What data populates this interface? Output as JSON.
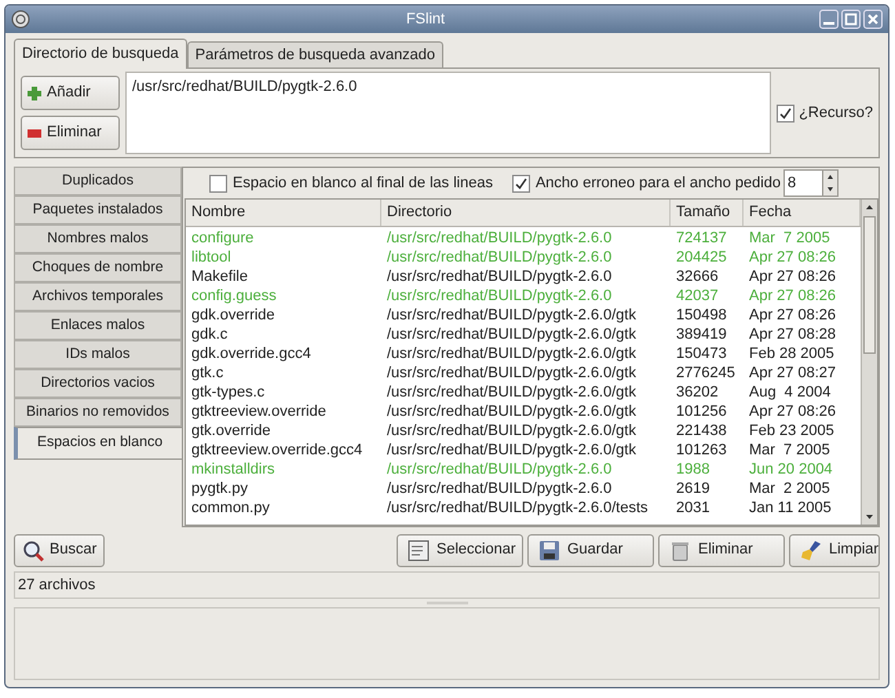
{
  "window": {
    "title": "FSlint"
  },
  "tabs": [
    {
      "label": "Directorio de busqueda",
      "selected": true
    },
    {
      "label": "Parámetros de busqueda avanzado",
      "selected": false
    }
  ],
  "dir_buttons": [
    "Añadir",
    "Eliminar"
  ],
  "directories": [
    "/usr/src/redhat/BUILD/pygtk-2.6.0"
  ],
  "recurse": {
    "label": "¿Recurso?",
    "checked": true
  },
  "side_tabs": [
    {
      "label": "Duplicados",
      "selected": false
    },
    {
      "label": "Paquetes instalados",
      "selected": false
    },
    {
      "label": "Nombres malos",
      "selected": false
    },
    {
      "label": "Choques de nombre",
      "selected": false
    },
    {
      "label": "Archivos temporales",
      "selected": false
    },
    {
      "label": "Enlaces malos",
      "selected": false
    },
    {
      "label": "IDs malos",
      "selected": false
    },
    {
      "label": "Directorios vacios",
      "selected": false
    },
    {
      "label": "Binarios no removidos",
      "selected": false
    },
    {
      "label": "Espacios en blanco",
      "selected": true
    }
  ],
  "options": [
    {
      "label": "Espacio en blanco al final de las lineas",
      "checked": false
    },
    {
      "label": "Ancho erroneo para el ancho pedido",
      "checked": true
    }
  ],
  "width_value": "8",
  "table": {
    "columns": [
      "Nombre",
      "Directorio",
      "Tamaño",
      "Fecha"
    ],
    "rows": [
      {
        "cells": [
          "configure",
          "/usr/src/redhat/BUILD/pygtk-2.6.0",
          "724137",
          "Mar  7 2005"
        ],
        "color": "#4caf3c"
      },
      {
        "cells": [
          "libtool",
          "/usr/src/redhat/BUILD/pygtk-2.6.0",
          "204425",
          "Apr 27 08:26"
        ],
        "color": "#4caf3c"
      },
      {
        "cells": [
          "Makefile",
          "/usr/src/redhat/BUILD/pygtk-2.6.0",
          "32666",
          "Apr 27 08:26"
        ],
        "color": "#222222"
      },
      {
        "cells": [
          "config.guess",
          "/usr/src/redhat/BUILD/pygtk-2.6.0",
          "42037",
          "Apr 27 08:26"
        ],
        "color": "#4caf3c"
      },
      {
        "cells": [
          "gdk.override",
          "/usr/src/redhat/BUILD/pygtk-2.6.0/gtk",
          "150498",
          "Apr 27 08:26"
        ],
        "color": "#222222"
      },
      {
        "cells": [
          "gdk.c",
          "/usr/src/redhat/BUILD/pygtk-2.6.0/gtk",
          "389419",
          "Apr 27 08:28"
        ],
        "color": "#222222"
      },
      {
        "cells": [
          "gdk.override.gcc4",
          "/usr/src/redhat/BUILD/pygtk-2.6.0/gtk",
          "150473",
          "Feb 28 2005"
        ],
        "color": "#222222"
      },
      {
        "cells": [
          "gtk.c",
          "/usr/src/redhat/BUILD/pygtk-2.6.0/gtk",
          "2776245",
          "Apr 27 08:27"
        ],
        "color": "#222222"
      },
      {
        "cells": [
          "gtk-types.c",
          "/usr/src/redhat/BUILD/pygtk-2.6.0/gtk",
          "36202",
          "Aug  4 2004"
        ],
        "color": "#222222"
      },
      {
        "cells": [
          "gtktreeview.override",
          "/usr/src/redhat/BUILD/pygtk-2.6.0/gtk",
          "101256",
          "Apr 27 08:26"
        ],
        "color": "#222222"
      },
      {
        "cells": [
          "gtk.override",
          "/usr/src/redhat/BUILD/pygtk-2.6.0/gtk",
          "221438",
          "Feb 23 2005"
        ],
        "color": "#222222"
      },
      {
        "cells": [
          "gtktreeview.override.gcc4",
          "/usr/src/redhat/BUILD/pygtk-2.6.0/gtk",
          "101263",
          "Mar  7 2005"
        ],
        "color": "#222222"
      },
      {
        "cells": [
          "mkinstalldirs",
          "/usr/src/redhat/BUILD/pygtk-2.6.0",
          "1988",
          "Jun 20 2004"
        ],
        "color": "#4caf3c"
      },
      {
        "cells": [
          "pygtk.py",
          "/usr/src/redhat/BUILD/pygtk-2.6.0",
          "2619",
          "Mar  2 2005"
        ],
        "color": "#222222"
      },
      {
        "cells": [
          "common.py",
          "/usr/src/redhat/BUILD/pygtk-2.6.0/tests",
          "2031",
          "Jan 11 2005"
        ],
        "color": "#222222"
      }
    ]
  },
  "search_button": "Buscar",
  "action_buttons": [
    {
      "label": "Seleccionar",
      "kind": "select"
    },
    {
      "label": "Guardar",
      "kind": "save"
    },
    {
      "label": "Eliminar",
      "kind": "delete"
    },
    {
      "label": "Limpiar",
      "kind": "clean"
    }
  ],
  "status_bar": "27 archivos"
}
